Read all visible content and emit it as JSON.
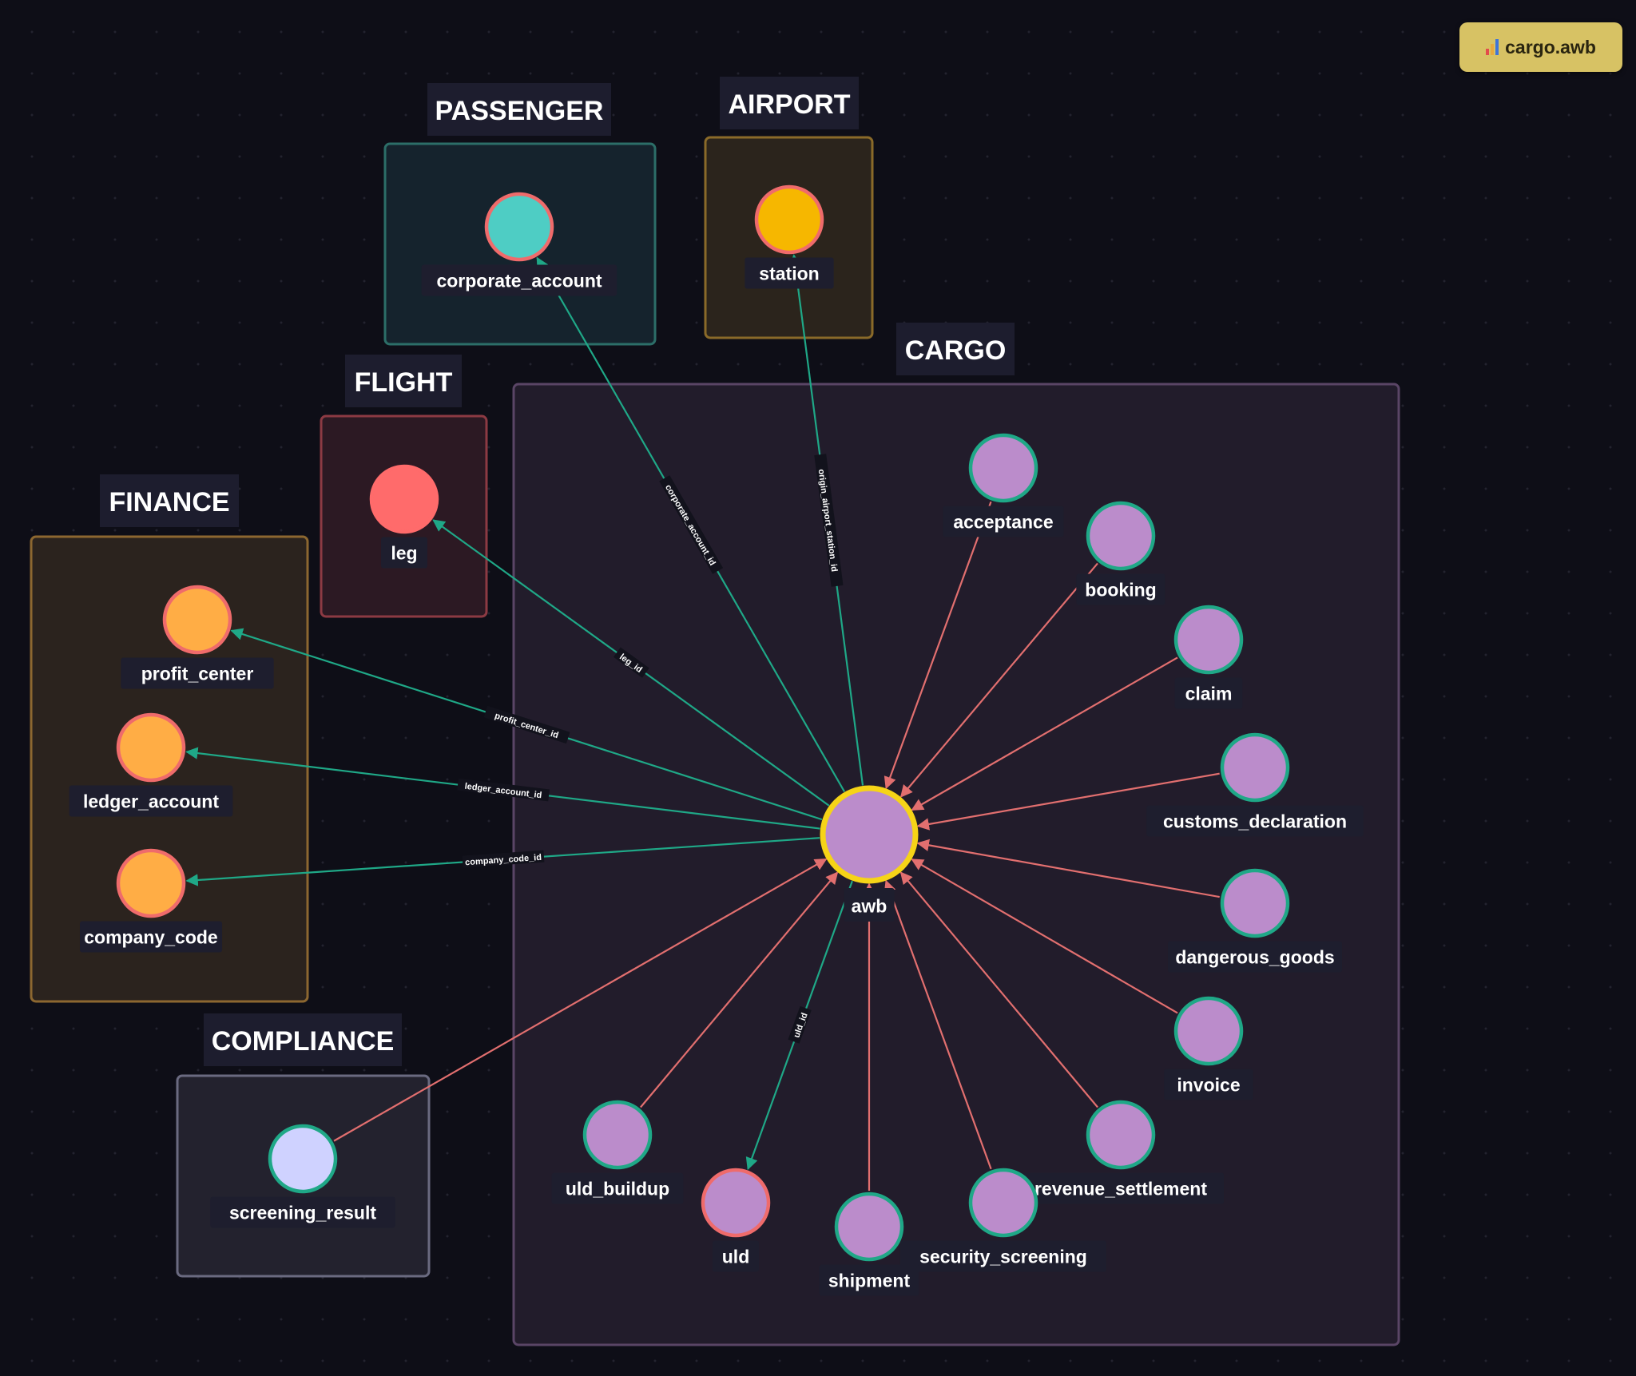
{
  "badge": {
    "icon": "bar-chart-icon",
    "label": "cargo.awb"
  },
  "colors": {
    "edge_outgoing": "#1fa887",
    "edge_incoming": "#e26f6f",
    "cargo_node": "#bb8ccb",
    "selected_ring": "#f6d417",
    "background": "#0e0e17"
  },
  "groups": [
    {
      "id": "passenger",
      "label": "PASSENGER",
      "border": "#2c6e68",
      "fill": "#15232d"
    },
    {
      "id": "airport",
      "label": "AIRPORT",
      "border": "#8a6a29",
      "fill": "#2b241c"
    },
    {
      "id": "flight",
      "label": "FLIGHT",
      "border": "#8c3a43",
      "fill": "#2c1923"
    },
    {
      "id": "finance",
      "label": "FINANCE",
      "border": "#8c6730",
      "fill": "#2b231e"
    },
    {
      "id": "cargo",
      "label": "CARGO",
      "border": "#5a4566",
      "fill": "#221c2b"
    },
    {
      "id": "compliance",
      "label": "COMPLIANCE",
      "border": "#6a6a80",
      "fill": "#23222e"
    }
  ],
  "nodes": [
    {
      "id": "corporate_account",
      "label": "corporate_account",
      "group": "passenger",
      "fill": "#4ecdc4",
      "border": "#ef6b6b"
    },
    {
      "id": "station",
      "label": "station",
      "group": "airport",
      "fill": "#f6b700",
      "border": "#ef6b6b"
    },
    {
      "id": "leg",
      "label": "leg",
      "group": "flight",
      "fill": "#ff6b6b",
      "border": "#ff6b6b"
    },
    {
      "id": "profit_center",
      "label": "profit_center",
      "group": "finance",
      "fill": "#ffad45",
      "border": "#ef6b6b"
    },
    {
      "id": "ledger_account",
      "label": "ledger_account",
      "group": "finance",
      "fill": "#ffad45",
      "border": "#ef6b6b"
    },
    {
      "id": "company_code",
      "label": "company_code",
      "group": "finance",
      "fill": "#ffad45",
      "border": "#ef6b6b"
    },
    {
      "id": "screening_result",
      "label": "screening_result",
      "group": "compliance",
      "fill": "#cfd2ff",
      "border": "#1fa887"
    },
    {
      "id": "awb",
      "label": "awb",
      "group": "cargo",
      "fill": "#bb8ccb",
      "border": "#f6d417",
      "selected": true
    },
    {
      "id": "acceptance",
      "label": "acceptance",
      "group": "cargo",
      "fill": "#bb8ccb",
      "border": "#1fa887"
    },
    {
      "id": "booking",
      "label": "booking",
      "group": "cargo",
      "fill": "#bb8ccb",
      "border": "#1fa887"
    },
    {
      "id": "claim",
      "label": "claim",
      "group": "cargo",
      "fill": "#bb8ccb",
      "border": "#1fa887"
    },
    {
      "id": "customs_declaration",
      "label": "customs_declaration",
      "group": "cargo",
      "fill": "#bb8ccb",
      "border": "#1fa887"
    },
    {
      "id": "dangerous_goods",
      "label": "dangerous_goods",
      "group": "cargo",
      "fill": "#bb8ccb",
      "border": "#1fa887"
    },
    {
      "id": "invoice",
      "label": "invoice",
      "group": "cargo",
      "fill": "#bb8ccb",
      "border": "#1fa887"
    },
    {
      "id": "revenue_settlement",
      "label": "revenue_settlement",
      "group": "cargo",
      "fill": "#bb8ccb",
      "border": "#1fa887"
    },
    {
      "id": "security_screening",
      "label": "security_screening",
      "group": "cargo",
      "fill": "#bb8ccb",
      "border": "#1fa887"
    },
    {
      "id": "shipment",
      "label": "shipment",
      "group": "cargo",
      "fill": "#bb8ccb",
      "border": "#1fa887"
    },
    {
      "id": "uld",
      "label": "uld",
      "group": "cargo",
      "fill": "#bb8ccb",
      "border": "#ef6b6b"
    },
    {
      "id": "uld_buildup",
      "label": "uld_buildup",
      "group": "cargo",
      "fill": "#bb8ccb",
      "border": "#1fa887"
    }
  ],
  "edges": [
    {
      "from": "awb",
      "to": "corporate_account",
      "label": "corporate_account_id",
      "kind": "outgoing"
    },
    {
      "from": "awb",
      "to": "station",
      "label": "origin_airport_station_id",
      "kind": "outgoing"
    },
    {
      "from": "awb",
      "to": "leg",
      "label": "leg_id",
      "kind": "outgoing"
    },
    {
      "from": "awb",
      "to": "profit_center",
      "label": "profit_center_id",
      "kind": "outgoing"
    },
    {
      "from": "awb",
      "to": "ledger_account",
      "label": "ledger_account_id",
      "kind": "outgoing"
    },
    {
      "from": "awb",
      "to": "company_code",
      "label": "company_code_id",
      "kind": "outgoing"
    },
    {
      "from": "awb",
      "to": "uld",
      "label": "uld_id",
      "kind": "outgoing"
    },
    {
      "from": "acceptance",
      "to": "awb",
      "label": "",
      "kind": "incoming"
    },
    {
      "from": "booking",
      "to": "awb",
      "label": "",
      "kind": "incoming"
    },
    {
      "from": "claim",
      "to": "awb",
      "label": "",
      "kind": "incoming"
    },
    {
      "from": "customs_declaration",
      "to": "awb",
      "label": "",
      "kind": "incoming"
    },
    {
      "from": "dangerous_goods",
      "to": "awb",
      "label": "",
      "kind": "incoming"
    },
    {
      "from": "invoice",
      "to": "awb",
      "label": "",
      "kind": "incoming"
    },
    {
      "from": "revenue_settlement",
      "to": "awb",
      "label": "",
      "kind": "incoming"
    },
    {
      "from": "security_screening",
      "to": "awb",
      "label": "",
      "kind": "incoming"
    },
    {
      "from": "shipment",
      "to": "awb",
      "label": "",
      "kind": "incoming"
    },
    {
      "from": "uld_buildup",
      "to": "awb",
      "label": "",
      "kind": "incoming"
    },
    {
      "from": "screening_result",
      "to": "awb",
      "label": "",
      "kind": "incoming"
    }
  ]
}
